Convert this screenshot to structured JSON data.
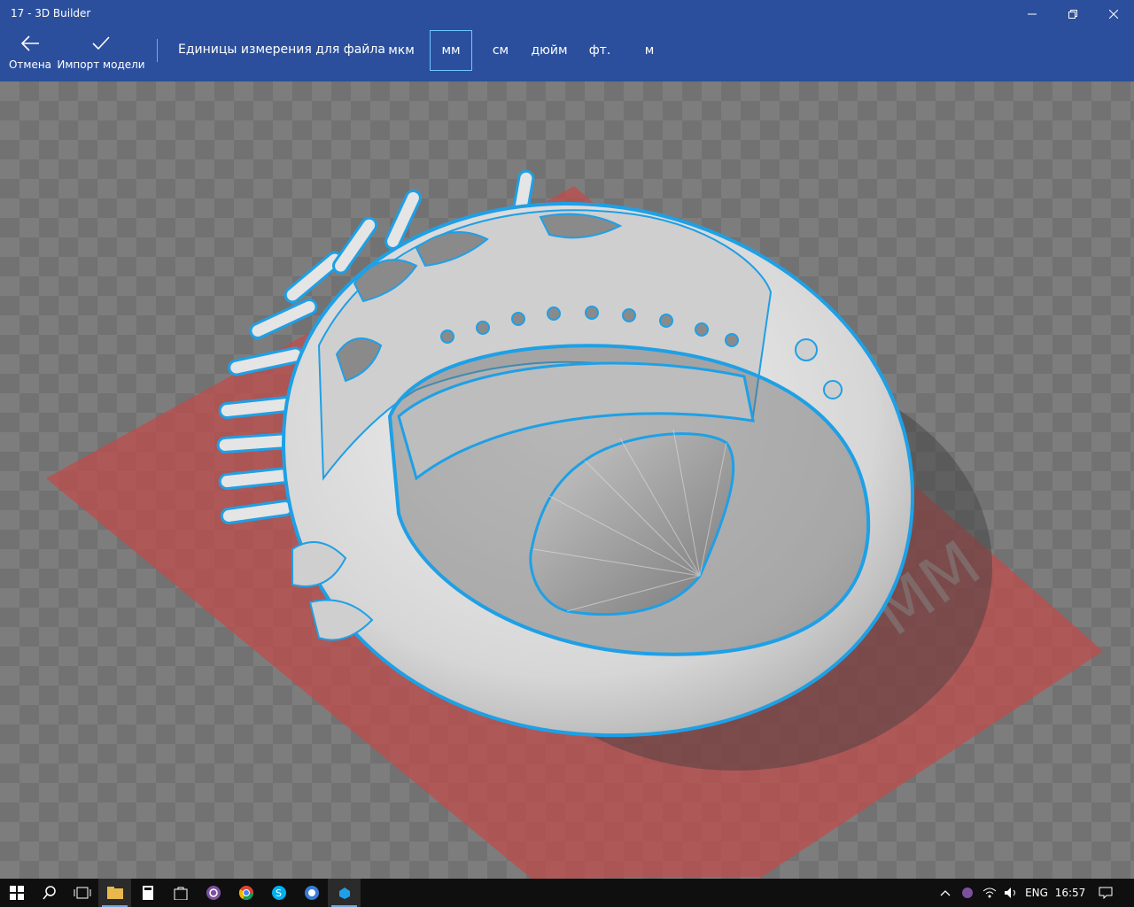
{
  "window": {
    "title": "17 - 3D Builder",
    "minimize_icon": "minimize-icon",
    "restore_icon": "restore-icon",
    "close_icon": "close-icon",
    "accent": "#2b4f9c"
  },
  "commandbar": {
    "cancel_label": "Отмена",
    "import_label": "Импорт модели",
    "units_label": "Единицы измерения для файла",
    "units": [
      {
        "label": "мкм",
        "selected": false
      },
      {
        "label": "мм",
        "selected": true
      },
      {
        "label": "см",
        "selected": false
      },
      {
        "label": "дюйм",
        "selected": false
      },
      {
        "label": "фт.",
        "selected": false
      },
      {
        "label": "м",
        "selected": false
      }
    ]
  },
  "viewport": {
    "plate_label": "МM",
    "model": "ring",
    "plate_color": "#c24a4a",
    "outline_color": "#1ea0e6"
  },
  "taskbar": {
    "apps": [
      "start-icon",
      "search-icon",
      "task-view-icon",
      "file-explorer-icon",
      "calculator-icon",
      "store-icon",
      "viber-icon",
      "chrome-icon",
      "skype-icon",
      "browser-icon",
      "3d-builder-icon"
    ],
    "language": "ENG",
    "time": "16:57"
  }
}
